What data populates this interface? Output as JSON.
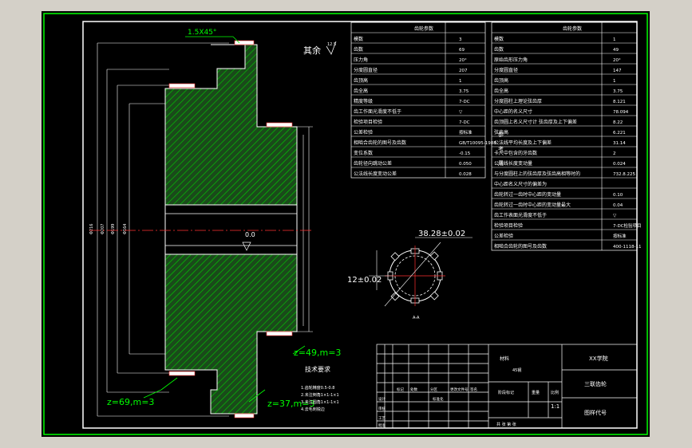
{
  "colors": {
    "background": "#000000",
    "frame": "#ffffff",
    "border": "#00ff00",
    "hatch": "#00ff00",
    "dim_red": "#ff2020",
    "centerline": "#ff3030",
    "gear_fill": "#1a5c1a"
  },
  "drawing": {
    "chamfer_note": "1.5X45°",
    "roughness_note": "其余",
    "hole_label": "0.0",
    "dim_spline_od": "38.28±0.02",
    "dim_spline_key": "12±0.02",
    "gear_labels": [
      "z=69,m=3",
      "z=37,m=3",
      "z=49,m=3"
    ],
    "tech_title": "技术要求",
    "tech_lines": [
      "1.齿轮精度0.5-0.8",
      "2.未注倒角1×1-1×1",
      "3.未注圆角1×1-1×1",
      "4.去毛刺锐边"
    ]
  },
  "table1": {
    "header": "齿轮参数",
    "rows": [
      [
        "模数",
        "3"
      ],
      [
        "齿数",
        "69"
      ],
      [
        "压力角",
        "20°"
      ],
      [
        "分度圆直径",
        "207"
      ],
      [
        "齿顶高",
        "1"
      ],
      [
        "齿全高",
        "3.75"
      ],
      [
        "精度等级",
        "7-DC"
      ],
      [
        "齿工作面光滑度不低于",
        "▽"
      ],
      [
        "检验项目检验",
        "7-DC"
      ],
      [
        "公差检验",
        "按标准"
      ],
      [
        "相啮合齿轮的图号及齿数",
        "GB/T10095-1988"
      ],
      [
        "变位系数",
        "-0.15"
      ],
      [
        "齿轮径向跳动公差",
        "0.050"
      ],
      [
        "公法线长度变动公差",
        "0.028"
      ]
    ]
  },
  "table2": {
    "header": "齿轮参数",
    "side_label": [
      "参",
      "考",
      "用"
    ],
    "rows": [
      [
        "模数",
        "1"
      ],
      [
        "齿数",
        "49"
      ],
      [
        "原始齿形压力角",
        "20°"
      ],
      [
        "分度圆直径",
        "147"
      ],
      [
        "齿顶高",
        "1"
      ],
      [
        "齿全高",
        "3.75"
      ],
      [
        "分度圆柱上理论弦齿厚",
        "8.121"
      ],
      [
        "中心距的名义尺寸",
        "78.094"
      ],
      [
        "齿顶圆上名义尺寸计 弦齿厚及上下偏差",
        "8.22"
      ],
      [
        "弦齿高",
        "6.221"
      ],
      [
        "公法线平均长度及上下偏差",
        "31.14"
      ],
      [
        "卡尺中包含的牙齿数",
        "2"
      ],
      [
        "公法线长度变动量",
        "0.024"
      ],
      [
        "与分度圆柱上的弦齿厚及弦齿高相等时的",
        "732.8.225"
      ],
      [
        "中心距名义尺寸的偏差为",
        ""
      ],
      [
        "齿轮转过一齿时中心距的变动量",
        "0.10"
      ],
      [
        "齿轮转过一齿时中心距的变动量最大",
        "0.04"
      ],
      [
        "齿工作表面光滑度不低于",
        "▽"
      ],
      [
        "检验项目检验",
        "7-DC检验项目"
      ],
      [
        "公差检验",
        "按标准"
      ],
      [
        "相啮合齿轮的图号及齿数",
        "400-1118-11"
      ]
    ]
  },
  "title_block": {
    "company": "XX学院",
    "part_name": "三联齿轮",
    "drawing_no": "图样代号",
    "material_label": "材料",
    "material": "45钢",
    "scale": "1:1",
    "stage_mark": "阶段标记",
    "weight": "重量",
    "ratio": "比例",
    "sheet": "共 张 第 张",
    "row_labels": [
      "标记",
      "处数",
      "分区",
      "更改文件号",
      "签名",
      "年月日"
    ],
    "roles": [
      "设计",
      "审核",
      "工艺",
      "批准",
      "标准化"
    ]
  }
}
